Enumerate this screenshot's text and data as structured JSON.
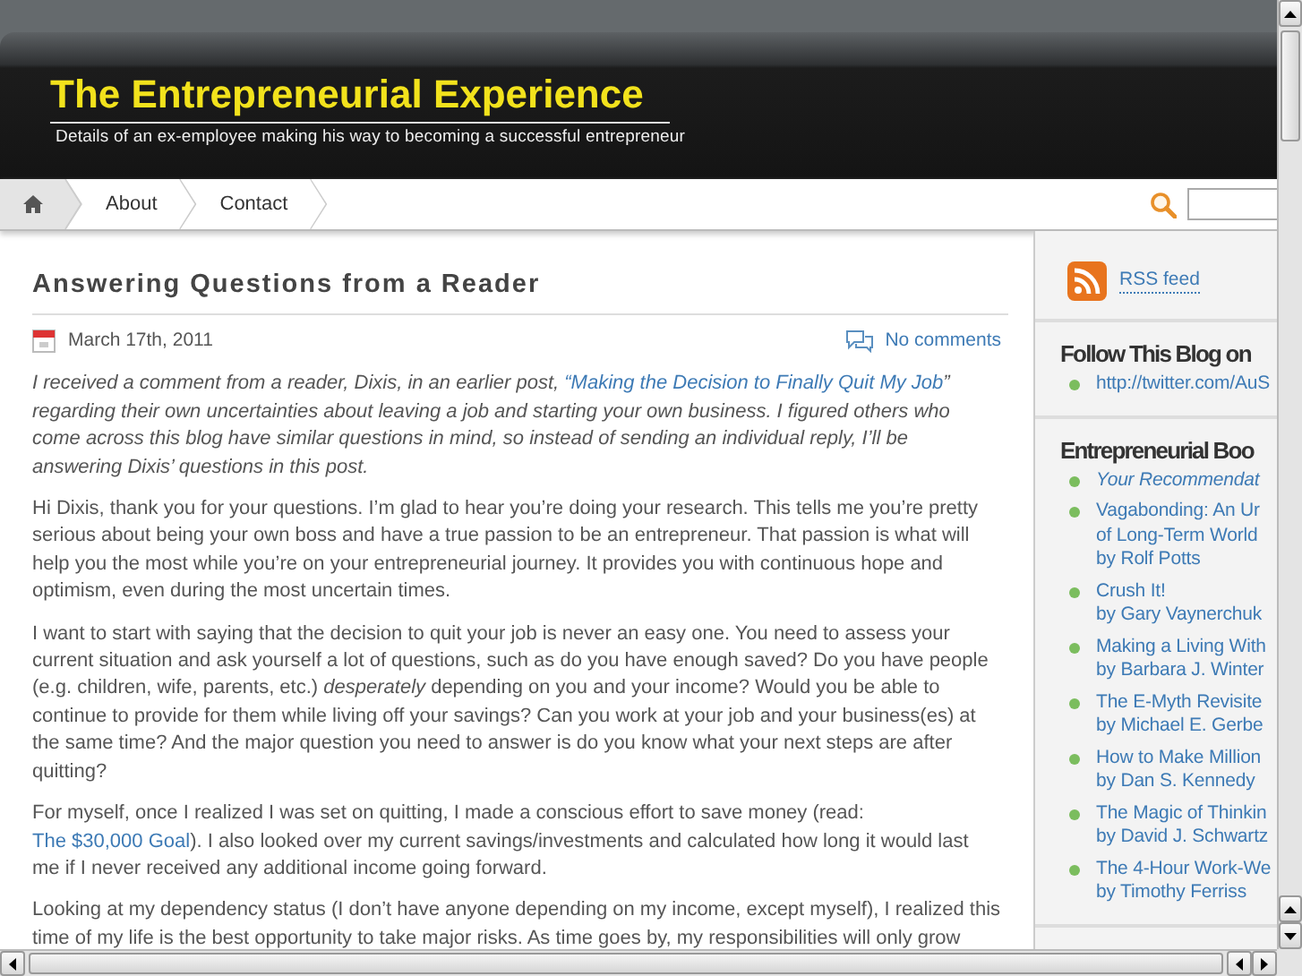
{
  "header": {
    "title": "The Entrepreneurial Experience",
    "tagline": "Details of an ex-employee making his way to becoming a successful entrepreneur"
  },
  "nav": {
    "items": [
      {
        "kind": "home",
        "selected": true
      },
      {
        "kind": "link",
        "label": "About",
        "selected": false
      },
      {
        "kind": "link",
        "label": "Contact",
        "selected": false
      }
    ]
  },
  "post": {
    "title": "Answering Questions from a Reader",
    "date": "March 17th, 2011",
    "comments": "No comments",
    "paragraphs": [
      {
        "kind": "intro",
        "parts": [
          {
            "kind": "text",
            "text": "I received a comment from a reader, Dixis, in an earlier post, "
          },
          {
            "kind": "link",
            "text": "“Making the Decision to Finally Quit My Job"
          },
          {
            "kind": "text",
            "text": "” regarding their own uncertainties about leaving a job and starting your own business.  I figured others who come across this blog have similar questions in mind, so instead of sending an individual reply, I’ll be answering Dixis’ questions in this post."
          }
        ]
      },
      {
        "kind": "body",
        "parts": [
          {
            "kind": "text",
            "text": "Hi Dixis, thank you for your questions. I’m glad to hear you’re doing your research.  This tells me you’re pretty serious about being your own boss and have a true passion to be an entrepreneur. That passion is what will help you the most while you’re on your entrepreneurial journey. It provides you with continuous hope and optimism, even during the most uncertain times."
          }
        ]
      },
      {
        "kind": "body",
        "parts": [
          {
            "kind": "text",
            "text": "I want to start with saying that the decision to quit your job is never an easy one.  You need to assess your current situation and ask yourself a lot of questions, such as do you have enough saved? Do you have people (e.g. children, wife, parents, etc.) *desperately* depending on you and your income? Would you be able to continue to provide for them while living off your savings? Can you work at your job and your business(es) at the same time? And the major question you need to answer is do you know what your next steps are after quitting?"
          }
        ]
      },
      {
        "kind": "body",
        "parts": [
          {
            "kind": "text",
            "text": "For myself, once I realized I was set on quitting, I made a conscious effort to save money (read: "
          },
          {
            "kind": "link",
            "text": "The $30,000 Goal"
          },
          {
            "kind": "text",
            "text": ").  I also looked over my current savings/investments and calculated how long it would last me if I never received any additional income going forward."
          }
        ]
      },
      {
        "kind": "body",
        "parts": [
          {
            "kind": "text",
            "text": "Looking at my dependency status (I don’t have anyone depending on my income, except myself), I realized this time of my life is the best opportunity to take major risks.  As time goes by, my responsibilities will only grow"
          }
        ]
      }
    ]
  },
  "sidebar": {
    "rss": "RSS feed",
    "widgets": [
      {
        "title": "Follow This Blog on",
        "items": [
          {
            "lines": [
              "http://twitter.com/AuS"
            ],
            "italic": false
          }
        ]
      },
      {
        "title": "Entrepreneurial Boo",
        "items": [
          {
            "lines": [
              "Your Recommendat"
            ],
            "italic": true
          },
          {
            "lines": [
              "Vagabonding: An Ur",
              "of Long-Term World",
              "by Rolf Potts"
            ],
            "italic": false
          },
          {
            "lines": [
              "Crush It!",
              "by Gary Vaynerchuk"
            ],
            "italic": false
          },
          {
            "lines": [
              "Making a Living With",
              "by Barbara J. Winter"
            ],
            "italic": false
          },
          {
            "lines": [
              "The E-Myth Revisite",
              "by Michael E. Gerbe"
            ],
            "italic": false
          },
          {
            "lines": [
              "How to Make Million",
              "by Dan S. Kennedy"
            ],
            "italic": false
          },
          {
            "lines": [
              "The Magic of Thinkin",
              "by David J. Schwartz"
            ],
            "italic": false
          },
          {
            "lines": [
              "The 4-Hour Work-We",
              "by Timothy Ferriss"
            ],
            "italic": false
          }
        ]
      }
    ]
  }
}
